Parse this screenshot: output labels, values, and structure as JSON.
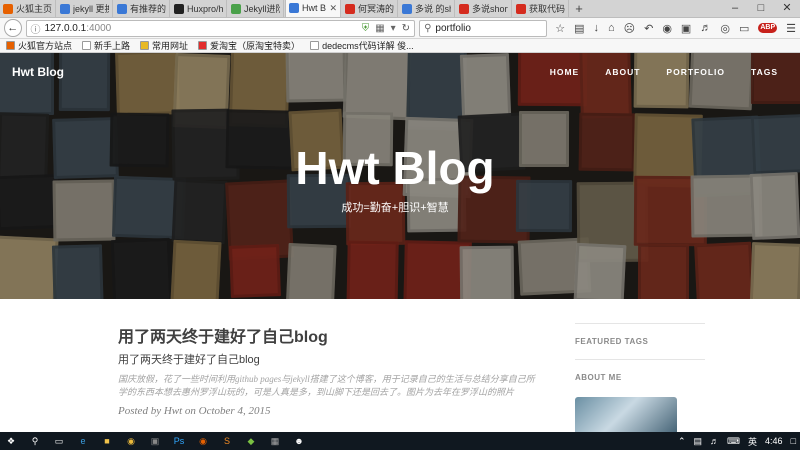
{
  "browser": {
    "tabs": [
      {
        "label": "火狐主页",
        "color": "#e66000",
        "active": false
      },
      {
        "label": "jekyll 更换...",
        "color": "#3a78d6",
        "active": false
      },
      {
        "label": "有推荐的简...",
        "color": "#3a78d6",
        "active": false
      },
      {
        "label": "Huxpro/hu...",
        "color": "#222222",
        "active": false
      },
      {
        "label": "Jekyll进阶...",
        "color": "#4aa14a",
        "active": false
      },
      {
        "label": "Hwt Bl...",
        "color": "#3a78d6",
        "active": true
      },
      {
        "label": "何冥涛的微...",
        "color": "#d52b1e",
        "active": false
      },
      {
        "label": "多说 的sho...",
        "color": "#3a78d6",
        "active": false
      },
      {
        "label": "多说short_...",
        "color": "#d52b1e",
        "active": false
      },
      {
        "label": "获取代码 -...",
        "color": "#d52b1e",
        "active": false
      }
    ],
    "new_tab": "+",
    "url_host": "127.0.0.1",
    "url_port": ":4000",
    "search_value": "portfolio",
    "bookmarks": [
      {
        "label": "火狐官方站点",
        "color": "#e66000"
      },
      {
        "label": "新手上路",
        "color": "#ffffff"
      },
      {
        "label": "常用网址",
        "color": "#e8b923"
      },
      {
        "label": "爱淘宝（原淘宝特卖）",
        "color": "#e22d2d"
      },
      {
        "label": "dedecms代码详解 俊...",
        "color": "#ffffff"
      }
    ]
  },
  "site": {
    "brand": "Hwt Blog",
    "menu": [
      "HOME",
      "ABOUT",
      "PORTFOLIO",
      "TAGS"
    ],
    "hero_title": "Hwt Blog",
    "hero_subtitle": "成功=勤奋+胆识+智慧"
  },
  "post": {
    "title": "用了两天终于建好了自己blog",
    "subtitle": "用了两天终于建好了自己blog",
    "excerpt": "国庆放假，花了一些时间利用github pages与jekyll搭建了这个博客，用于记录自己的生活与总结分享自己所学的东西本想去惠州罗浮山玩的，可是人真是多，到山脚下还是回去了。图片为去年在罗浮山的照片",
    "meta": "Posted by Hwt on October 4, 2015"
  },
  "sidebar": {
    "featured_tags": "FEATURED TAGS",
    "about_me": "ABOUT ME"
  },
  "taskbar": {
    "lang": "英",
    "time": "4:46"
  },
  "colors": {
    "tab_strip": "#d3d3d3",
    "toolbar": "#f7f7f7",
    "taskbar": "#101820",
    "heading_text": "#404040",
    "muted_text": "#a3a3a3"
  }
}
